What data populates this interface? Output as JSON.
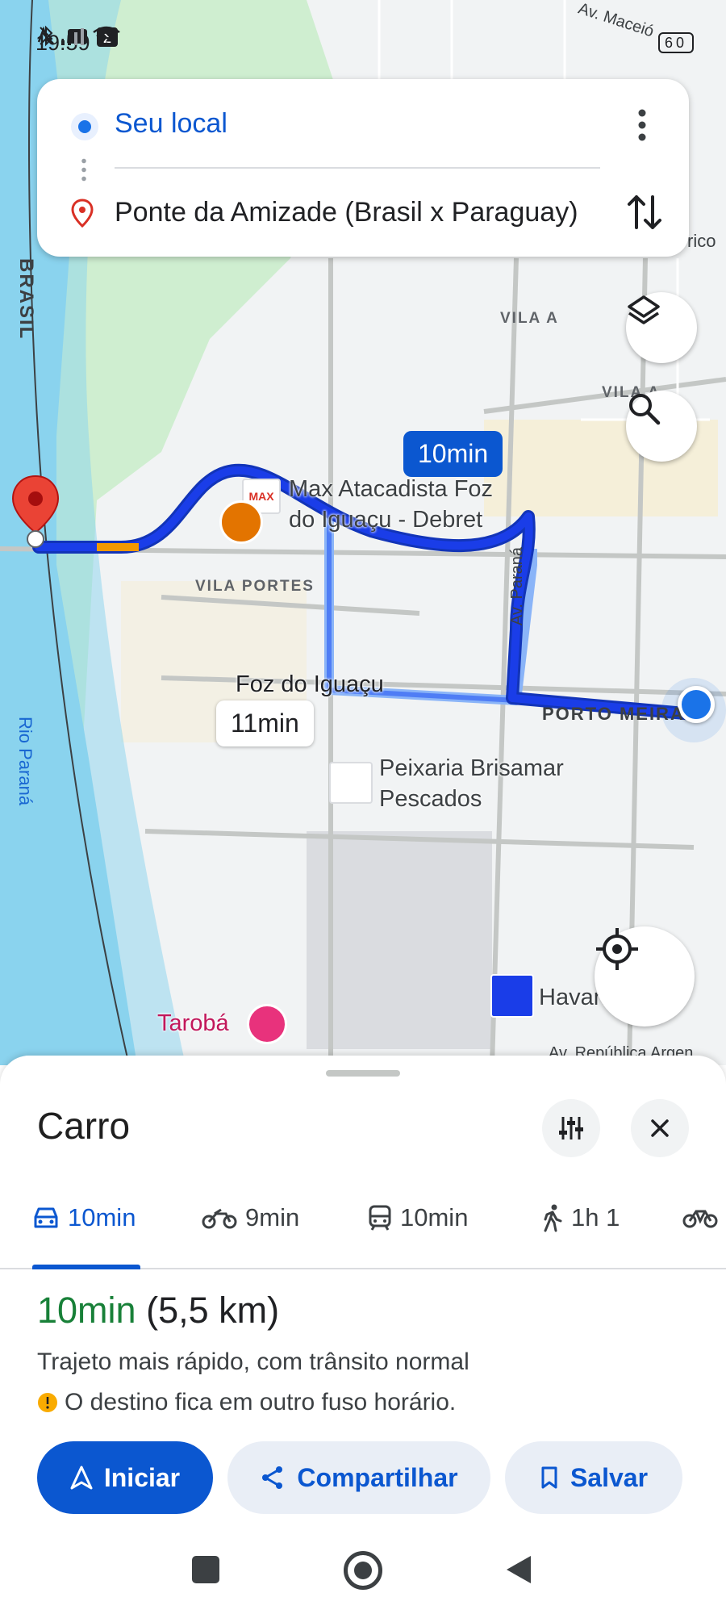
{
  "status_bar": {
    "time": "19:59",
    "battery": "60"
  },
  "route": {
    "origin": "Seu local",
    "destination": "Ponte da Amizade (Brasil x Paraguay)"
  },
  "map": {
    "primary_route_time": "10min",
    "alt_route_time": "11min",
    "labels": {
      "max": "Max Atacadista Foz do Iguaçu - Debret",
      "vila_portes": "VILA PORTES",
      "foz": "Foz do Iguaçu",
      "peixaria": "Peixaria Brisamar Pescados",
      "taroba": "Tarobá",
      "havan": "Havan",
      "vila_a": "VILA A",
      "vila_a2": "VILA A",
      "brasil": "BRASIL",
      "rio": "Rio Paraná",
      "av_parana": "Av. Paraná",
      "porto_meira": "PORTO MEIRA",
      "av_maceio": "Av. Maceió",
      "av_republica": "Av. República Argen",
      "rico": "rico"
    }
  },
  "sheet": {
    "title": "Carro",
    "tabs": [
      {
        "label": "10min",
        "icon": "car-icon",
        "active": true
      },
      {
        "label": "9min",
        "icon": "motorcycle-icon",
        "active": false
      },
      {
        "label": "10min",
        "icon": "transit-icon",
        "active": false
      },
      {
        "label": "1h 1",
        "icon": "walk-icon",
        "active": false
      }
    ],
    "duration": "10min",
    "distance": "(5,5 km)",
    "description": "Trajeto mais rápido, com trânsito normal",
    "warning": "O destino fica em outro fuso horário.",
    "buttons": {
      "start": "Iniciar",
      "share": "Compartilhar",
      "save": "Salvar"
    }
  },
  "colors": {
    "accent": "#0b57d0",
    "route": "#1a3de8",
    "duration": "#188038",
    "river": "#8ad3ee",
    "park": "#cfeed0"
  }
}
